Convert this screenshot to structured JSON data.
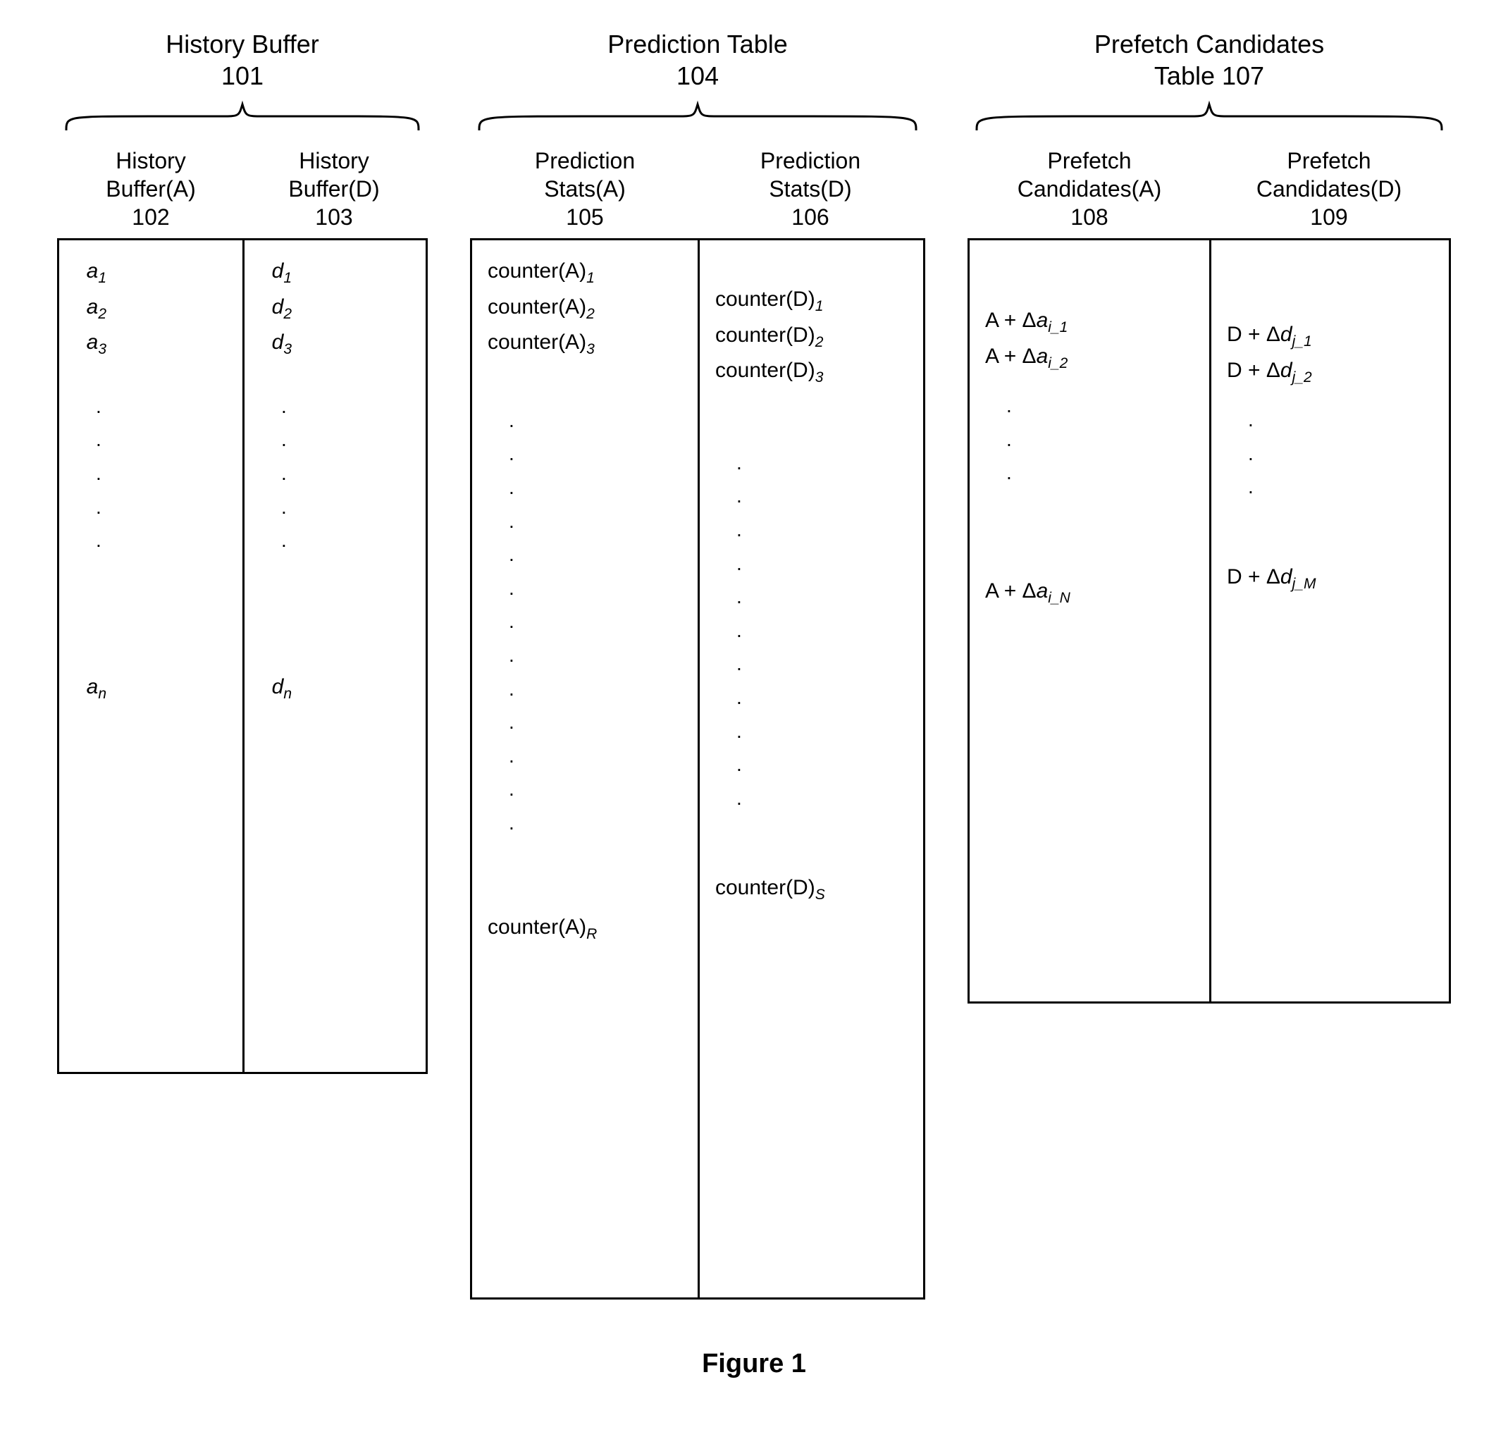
{
  "caption": "Figure 1",
  "groups": {
    "history": {
      "title_line1": "History Buffer",
      "title_line2": "101",
      "colA": {
        "h1": "History",
        "h2": "Buffer(A)",
        "h3": "102",
        "r1": "a",
        "s1": "1",
        "r2": "a",
        "s2": "2",
        "r3": "a",
        "s3": "3",
        "rn": "a",
        "sn": "n"
      },
      "colB": {
        "h1": "History",
        "h2": "Buffer(D)",
        "h3": "103",
        "r1": "d",
        "s1": "1",
        "r2": "d",
        "s2": "2",
        "r3": "d",
        "s3": "3",
        "rn": "d",
        "sn": "n"
      }
    },
    "prediction": {
      "title_line1": "Prediction Table",
      "title_line2": "104",
      "colA": {
        "h1": "Prediction",
        "h2": "Stats(A)",
        "h3": "105",
        "r1a": "counter(A)",
        "r1b": "1",
        "r2a": "counter(A)",
        "r2b": "2",
        "r3a": "counter(A)",
        "r3b": "3",
        "rna": "counter(A)",
        "rnb": "R"
      },
      "colB": {
        "h1": "Prediction",
        "h2": "Stats(D)",
        "h3": "106",
        "r1a": "counter(D)",
        "r1b": "1",
        "r2a": "counter(D)",
        "r2b": "2",
        "r3a": "counter(D)",
        "r3b": "3",
        "rna": "counter(D)",
        "rnb": "S"
      }
    },
    "prefetch": {
      "title_line1": "Prefetch Candidates",
      "title_line2": "Table 107",
      "colA": {
        "h1": "Prefetch",
        "h2": "Candidates(A)",
        "h3": "108",
        "r1a": "A + ",
        "r1b": "a",
        "r1c": "i_1",
        "r2a": "A + ",
        "r2b": "a",
        "r2c": "i_2",
        "rna": "A + ",
        "rnb": "a",
        "rnc": "i_N"
      },
      "colB": {
        "h1": "Prefetch",
        "h2": "Candidates(D)",
        "h3": "109",
        "r1a": "D + ",
        "r1b": "d",
        "r1c": "j_1",
        "r2a": "D + ",
        "r2b": "d",
        "r2c": "j_2",
        "rna": "D + ",
        "rnb": "d",
        "rnc": "j_M"
      }
    }
  }
}
